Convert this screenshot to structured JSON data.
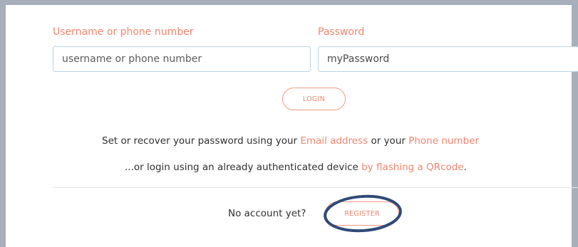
{
  "form": {
    "username_label": "Username or phone number",
    "username_placeholder": "username or phone number",
    "password_label": "Password",
    "password_value": "myPassword",
    "login_label": "LOGIN"
  },
  "recover": {
    "prefix": "Set or recover your password using your ",
    "email_link": "Email address",
    "middle": " or your ",
    "phone_link": "Phone number"
  },
  "qr": {
    "prefix": "...or login using an already authenticated device ",
    "link": "by flashing a QRcode",
    "suffix": "."
  },
  "register": {
    "prompt": "No account yet?",
    "button_label": "REGISTER"
  },
  "colors": {
    "accent": "#f0866f",
    "annotation_ring": "#2f4a78",
    "frame": "#a7afbb"
  }
}
